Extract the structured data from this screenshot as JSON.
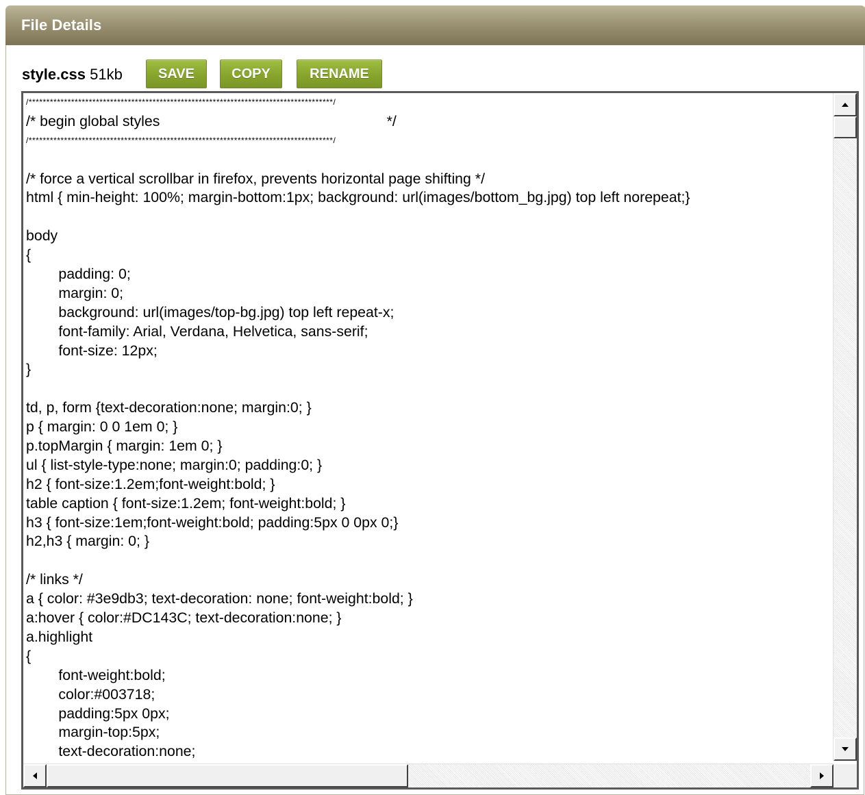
{
  "panel": {
    "title": "File Details"
  },
  "file": {
    "name": "style.css",
    "size": "51kb"
  },
  "actions": {
    "save": "SAVE",
    "copy": "COPY",
    "rename": "RENAME"
  },
  "editor": {
    "lines": [
      "/**************************************************************************************/",
      "/* begin global styles\t\t\t\t\t\t\t\t\t\t\t\t\t\t */",
      "/**************************************************************************************/",
      "",
      "/* force a vertical scrollbar in firefox, prevents horizontal page shifting */",
      "html { min-height: 100%; margin-bottom:1px; background: url(images/bottom_bg.jpg) top left norepeat;}",
      "",
      "body",
      "{",
      "\t\tpadding: 0;",
      "\t\tmargin: 0;",
      "\t\tbackground: url(images/top-bg.jpg) top left repeat-x;",
      "\t\tfont-family: Arial, Verdana, Helvetica, sans-serif;",
      "\t\tfont-size: 12px;",
      "}",
      "",
      "td, p, form {text-decoration:none; margin:0; }",
      "p { margin: 0 0 1em 0; }",
      "p.topMargin { margin: 1em 0; }",
      "ul { list-style-type:none; margin:0; padding:0; }",
      "h2 { font-size:1.2em;font-weight:bold; }",
      "table caption { font-size:1.2em; font-weight:bold; }",
      "h3 { font-size:1em;font-weight:bold; padding:5px 0 0px 0;}",
      "h2,h3 { margin: 0; }",
      "",
      "/* links */",
      "a { color: #3e9db3; text-decoration: none; font-weight:bold; }",
      "a:hover { color:#DC143C; text-decoration:none; }",
      "a.highlight",
      "{",
      "\t\tfont-weight:bold;",
      "\t\tcolor:#003718;",
      "\t\tpadding:5px 0px;",
      "\t\tmargin-top:5px;",
      "\t\ttext-decoration:none;"
    ]
  },
  "colors": {
    "header_gradient": [
      "#bcb59a",
      "#7d7457"
    ],
    "button_green": "#87a52c",
    "title_text": "#ffffff"
  },
  "icons": [
    "arrow-up-icon",
    "arrow-down-icon",
    "arrow-left-icon",
    "arrow-right-icon"
  ]
}
